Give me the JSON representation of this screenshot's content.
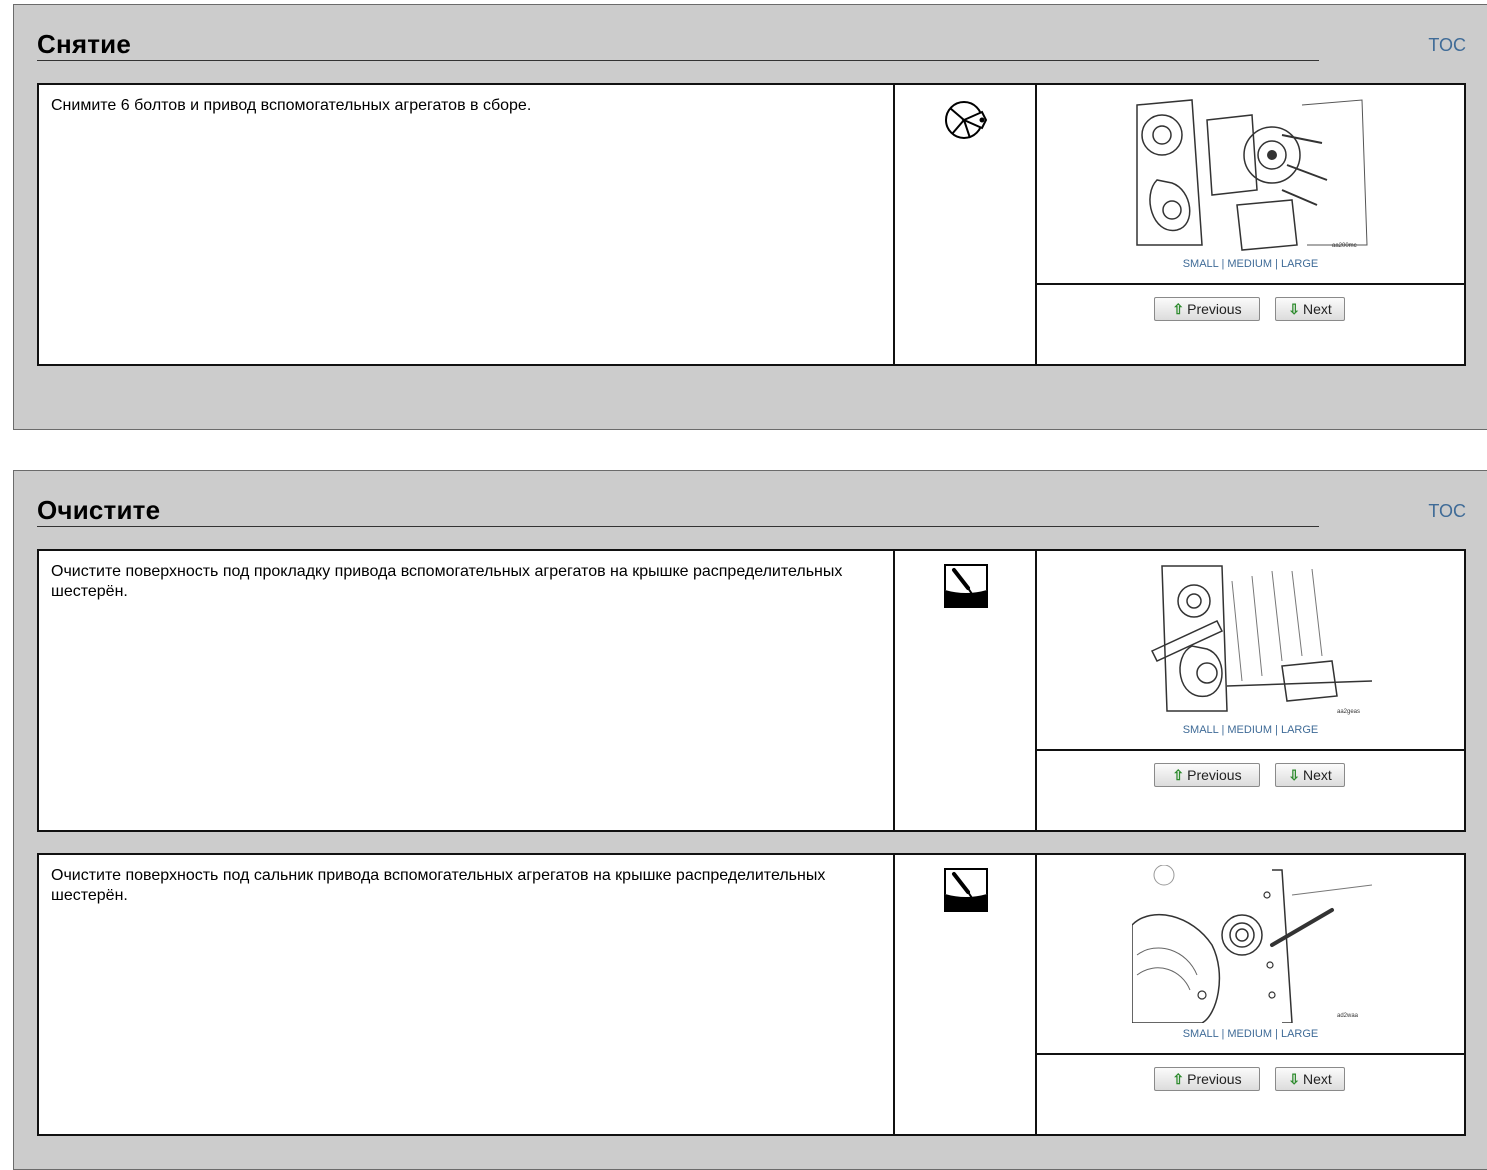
{
  "sections": [
    {
      "title": "Снятие",
      "toc_label": "TOC",
      "steps": [
        {
          "text": "Снимите 6 болтов и привод вспомогательных агрегатов в сборе.",
          "icon": "remove-tool-icon",
          "figure_id": "aa200mc",
          "size_links": [
            "SMALL",
            "MEDIUM",
            "LARGE"
          ],
          "prev_label": "Previous",
          "next_label": "Next"
        }
      ]
    },
    {
      "title": "Очистите",
      "toc_label": "TOC",
      "steps": [
        {
          "text": "Очистите поверхность под прокладку привода вспомогательных агрегатов на крышке распределительных шестерён.",
          "icon": "scraper-clean-icon",
          "figure_id": "aa2geas",
          "size_links": [
            "SMALL",
            "MEDIUM",
            "LARGE"
          ],
          "prev_label": "Previous",
          "next_label": "Next"
        },
        {
          "text": "Очистите поверхность под сальник привода вспомогательных агрегатов на крышке распределительных шестерён.",
          "icon": "scraper-clean-icon",
          "figure_id": "ad2waa",
          "size_links": [
            "SMALL",
            "MEDIUM",
            "LARGE"
          ],
          "prev_label": "Previous",
          "next_label": "Next"
        }
      ]
    }
  ],
  "colors": {
    "panel_bg": "#cccccc",
    "link": "#3f6b97",
    "arrow": "#2e8b2e"
  }
}
